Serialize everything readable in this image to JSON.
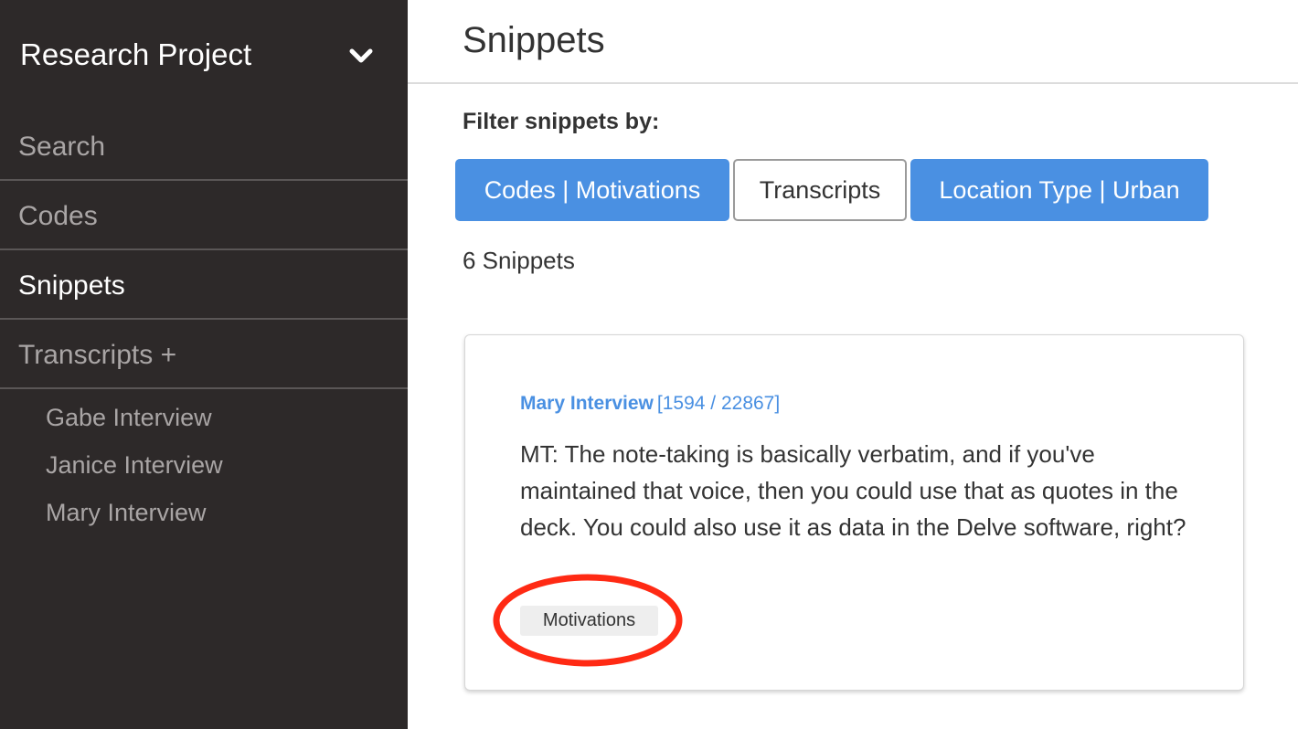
{
  "sidebar": {
    "project_title": "Research Project",
    "nav": [
      {
        "label": "Search"
      },
      {
        "label": "Codes"
      },
      {
        "label": "Snippets"
      },
      {
        "label": "Transcripts +"
      }
    ],
    "transcripts": [
      {
        "label": "Gabe Interview"
      },
      {
        "label": "Janice Interview"
      },
      {
        "label": "Mary Interview"
      }
    ]
  },
  "main": {
    "title": "Snippets",
    "filter_heading": "Filter snippets by:",
    "filters": [
      {
        "label": "Codes | Motivations",
        "style": "primary"
      },
      {
        "label": "Transcripts",
        "style": "outline"
      },
      {
        "label": "Location Type | Urban",
        "style": "primary"
      }
    ],
    "snippet_count": "6 Snippets",
    "snippets": [
      {
        "source": "Mary Interview",
        "range": "[1594 / 22867]",
        "text": "MT: The note-taking is basically verbatim, and if you've maintained that voice, then you could use that as quotes in the deck. You could also use it as data in the Delve software, right?",
        "tag": "Motivations"
      }
    ]
  },
  "colors": {
    "sidebar_bg": "#2d2929",
    "accent": "#4a90e2",
    "annotation_ring": "#ff2a14"
  },
  "icons": {
    "project_menu": "chevron-down-icon"
  }
}
